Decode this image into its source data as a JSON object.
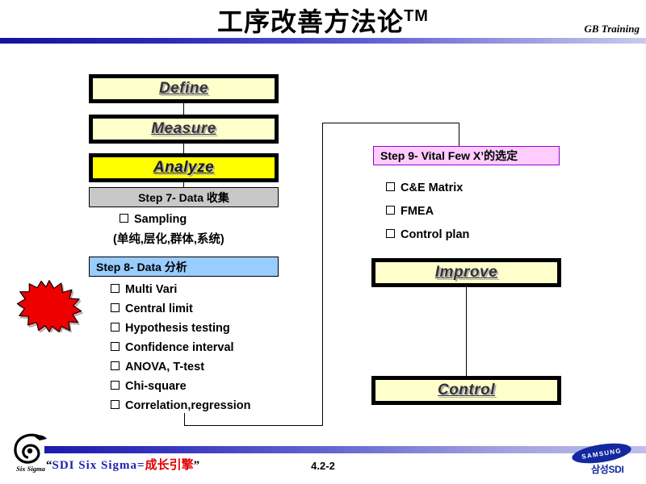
{
  "header": {
    "title_main": "工序改善方法论",
    "title_tm": "TM",
    "right_label": "GB Training"
  },
  "phases": {
    "define": "Define",
    "measure": "Measure",
    "analyze": "Analyze",
    "improve": "Improve",
    "control": "Control"
  },
  "step7": {
    "header": "Step 7- Data 收集",
    "bullets": [
      "Sampling"
    ],
    "note": "(单纯,层化,群体,系统)"
  },
  "step8": {
    "header": "Step 8- Data 分析",
    "bullets": [
      "Multi Vari",
      "Central limit",
      "Hypothesis testing",
      "Confidence interval",
      "ANOVA, T-test",
      "Chi-square",
      "Correlation,regression"
    ]
  },
  "step9": {
    "header": "Step 9- Vital Few X’的选定",
    "bullets": [
      "C&E Matrix",
      "FMEA",
      "Control plan"
    ]
  },
  "footer": {
    "logo_label": "Six Sigma",
    "quote_open": "“",
    "slogan_en": "SDI  Six  Sigma",
    "equals": "=",
    "slogan_cn": "成长引擎",
    "quote_close": "”",
    "page_number": "4.2-2",
    "brand_word": "SAMSUNG",
    "brand_sub": "삼성SDI"
  },
  "colors": {
    "phase_fill": "#ffffcc",
    "phase_highlight": "#ffff00",
    "step7_fill": "#c8c8c8",
    "step8_fill": "#99ccff",
    "step9_fill": "#ffccff",
    "accent_blue": "#1f1fb0",
    "accent_red": "#e00000",
    "brand_blue": "#1428a0"
  },
  "decor": {
    "starburst": "red-starburst-shape"
  }
}
